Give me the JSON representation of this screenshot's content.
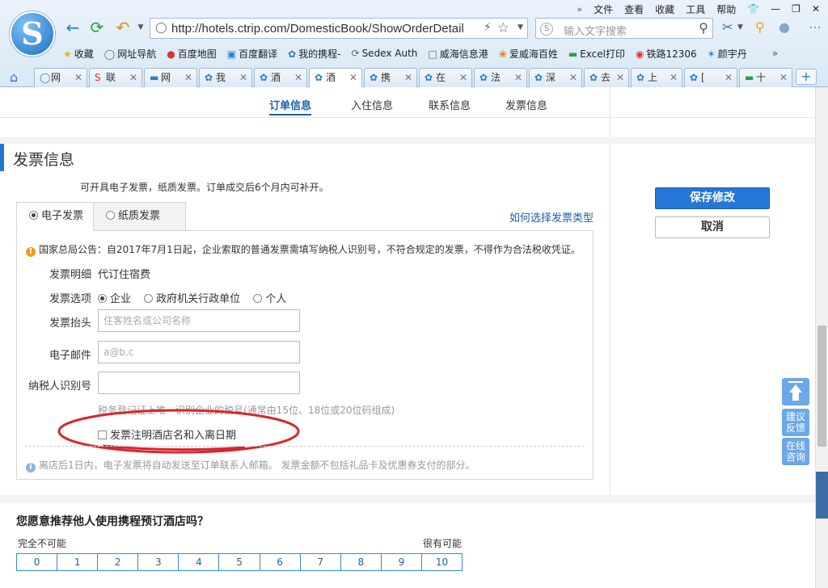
{
  "browser": {
    "menu": [
      "文件",
      "查看",
      "收藏",
      "工具",
      "帮助"
    ],
    "url": "http://hotels.ctrip.com/DomesticBook/ShowOrderDetail",
    "search_placeholder": "输入文字搜索",
    "bookmarks": [
      "收藏",
      "网址导航",
      "百度地图",
      "百度翻译",
      "我的携程-",
      "Sedex Auth",
      "威海信息港",
      "爱威海百姓",
      "Excel打印",
      "铁路12306",
      "颜宇丹"
    ],
    "tabs": [
      "网",
      "联",
      "网",
      "我",
      "酒",
      "酒",
      "携",
      "在",
      "法",
      "深",
      "去",
      "上",
      "[",
      "十"
    ]
  },
  "order_nav": [
    "订单信息",
    "入住信息",
    "联系信息",
    "发票信息"
  ],
  "section": {
    "title": "发票信息",
    "intro": "可开具电子发票，纸质发票。订单成交后6个月内可补开。"
  },
  "invoice_tabs": {
    "electronic": "电子发票",
    "paper": "纸质发票",
    "help_link": "如何选择发票类型"
  },
  "form": {
    "notice": "国家总局公告：自2017年7月1日起，企业索取的普通发票需填写纳税人识别号，不符合规定的发票，不得作为合法税收凭证。",
    "detail_label": "发票明细",
    "detail_value": "代订住宿费",
    "option_label": "发票选项",
    "options": [
      "企业",
      "政府机关行政单位",
      "个人"
    ],
    "title_label": "发票抬头",
    "title_placeholder": "住客姓名或公司名称",
    "email_label": "电子邮件",
    "email_placeholder": "a@b.c",
    "taxid_label": "纳税人识别号",
    "taxid_value": "",
    "taxid_hint": "税务登记证上唯一识别企业的税号(通常由15位、18位或20位码组成)",
    "checkbox_label": "发票注明酒店名和入离日期",
    "info_note": "离店后1日内，电子发票将自动发送至订单联系人邮箱。 发票金额不包括礼品卡及优惠券支付的部分。"
  },
  "side": {
    "save": "保存修改",
    "cancel": "取消",
    "feedback": [
      "建议",
      "反馈"
    ],
    "chat": [
      "在线",
      "咨询"
    ]
  },
  "recommend": {
    "title": "您愿意推荐他人使用携程预订酒店吗？",
    "low": "完全不可能",
    "high": "很有可能",
    "scale": [
      "0",
      "1",
      "2",
      "3",
      "4",
      "5",
      "6",
      "7",
      "8",
      "9",
      "10"
    ]
  },
  "colors": {
    "accent": "#2577d6",
    "annotation": "#d9262c"
  }
}
